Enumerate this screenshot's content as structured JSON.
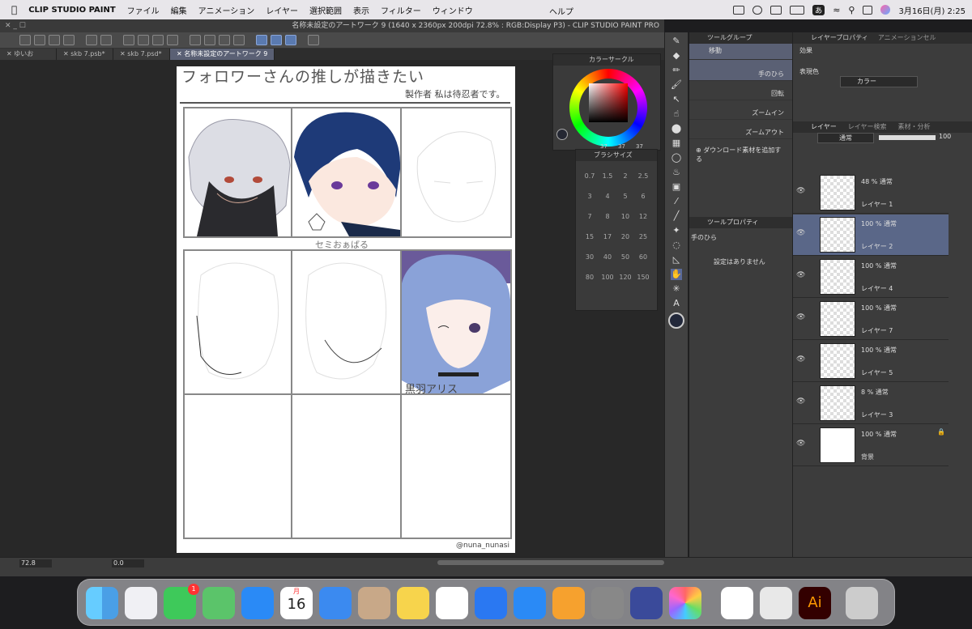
{
  "menubar": {
    "app_name": "CLIP STUDIO PAINT",
    "items": [
      "ファイル",
      "編集",
      "アニメーション",
      "レイヤー",
      "選択範囲",
      "表示",
      "フィルター",
      "ウィンドウ"
    ],
    "help": "ヘルプ",
    "input_mode": "あ",
    "clock": "3月16日(月)  2:25"
  },
  "window": {
    "title": "名称未設定のアートワーク 9 (1640 x 2360px 200dpi 72.8% : RGB:Display P3)  - CLIP STUDIO PAINT PRO"
  },
  "tabs": [
    "ゆいお",
    "skb 7.psb*",
    "skb 7.psd*",
    "名称未設定のアートワーク 9"
  ],
  "artwork": {
    "title": "フォロワーさんの推しが描きたい",
    "author": "製作者 私は待忍者です。",
    "caption1": "セミおぁばる",
    "caption2": "黒羽アリス",
    "credit": "@nuna_nunasi"
  },
  "status": {
    "zoom": "72.8",
    "angle": "0.0"
  },
  "color_circle": {
    "title": "カラーサークル",
    "values": [
      "37",
      "37",
      "37"
    ]
  },
  "brush_size": {
    "title": "ブラシサイズ",
    "sizes": [
      "0.7",
      "1.5",
      "2",
      "2.5",
      "3",
      "4",
      "5",
      "6",
      "7",
      "8",
      "10",
      "12",
      "15",
      "17",
      "20",
      "25",
      "30",
      "40",
      "50",
      "60",
      "80",
      "100",
      "120",
      "150"
    ]
  },
  "tool_group": {
    "title": "ツールグループ",
    "tabs_right": "ツール"
  },
  "subtools": [
    {
      "label": "移動",
      "sub": ""
    },
    {
      "label": "手のひら",
      "sub": "手のひら"
    },
    {
      "label": "",
      "sub": "回転"
    },
    {
      "label": "",
      "sub": "ズームイン"
    },
    {
      "label": "",
      "sub": "ズームアウト"
    }
  ],
  "add_material": "ダウンロード素材を追加する",
  "tool_property": {
    "title": "ツールプロパティ",
    "tool": "手のひら",
    "message": "設定はありません"
  },
  "layer_property": {
    "title": "レイヤープロパティ",
    "tab2": "アニメーションセル",
    "effect_label": "効果",
    "expression_label": "表現色",
    "expression_value": "カラー"
  },
  "layer_panel": {
    "title": "レイヤー",
    "tab2": "レイヤー検索",
    "tab3": "素材・分析",
    "blend": "通常",
    "opacity": "100"
  },
  "layers": [
    {
      "blend": "48 % 通常",
      "name": "レイヤー 1"
    },
    {
      "blend": "100 % 通常",
      "name": "レイヤー 2"
    },
    {
      "blend": "100 % 通常",
      "name": "レイヤー 4"
    },
    {
      "blend": "100 % 通常",
      "name": "レイヤー 7"
    },
    {
      "blend": "100 % 通常",
      "name": "レイヤー 5"
    },
    {
      "blend": "8 % 通常",
      "name": "レイヤー 3"
    },
    {
      "blend": "100 % 通常",
      "name": "背景"
    }
  ],
  "dock": {
    "calendar_month": "月",
    "calendar_day": "16",
    "messages_badge": "1"
  }
}
